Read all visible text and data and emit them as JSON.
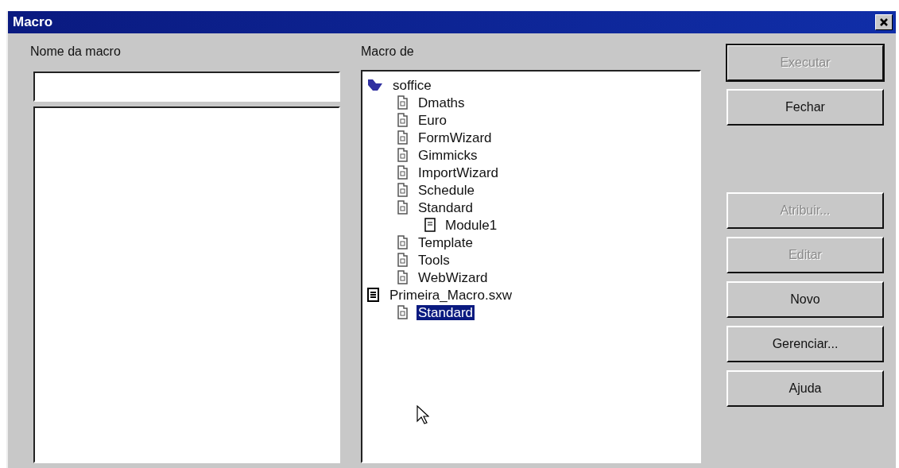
{
  "window": {
    "title": "Macro"
  },
  "macro_name": {
    "label": "Nome da macro"
  },
  "macro_from": {
    "label": "Macro de",
    "tree": [
      {
        "label": "soffice",
        "kind": "root",
        "selected": false,
        "children": [
          {
            "label": "Dmaths",
            "kind": "library",
            "selected": false
          },
          {
            "label": "Euro",
            "kind": "library",
            "selected": false
          },
          {
            "label": "FormWizard",
            "kind": "library",
            "selected": false
          },
          {
            "label": "Gimmicks",
            "kind": "library",
            "selected": false
          },
          {
            "label": "ImportWizard",
            "kind": "library",
            "selected": false
          },
          {
            "label": "Schedule",
            "kind": "library",
            "selected": false
          },
          {
            "label": "Standard",
            "kind": "library",
            "selected": false,
            "children": [
              {
                "label": "Module1",
                "kind": "module",
                "selected": false
              }
            ]
          },
          {
            "label": "Template",
            "kind": "library",
            "selected": false
          },
          {
            "label": "Tools",
            "kind": "library",
            "selected": false
          },
          {
            "label": "WebWizard",
            "kind": "library",
            "selected": false
          }
        ]
      },
      {
        "label": "Primeira_Macro.sxw",
        "kind": "document",
        "selected": false,
        "children": [
          {
            "label": "Standard",
            "kind": "library",
            "selected": true
          }
        ]
      }
    ]
  },
  "buttons": [
    {
      "label": "Executar",
      "disabled": true,
      "default": true
    },
    {
      "label": "Fechar",
      "disabled": false,
      "default": false
    },
    {
      "label": "Atribuir...",
      "disabled": true,
      "default": false
    },
    {
      "label": "Editar",
      "disabled": true,
      "default": false
    },
    {
      "label": "Novo",
      "disabled": false,
      "default": false
    },
    {
      "label": "Gerenciar...",
      "disabled": false,
      "default": false
    },
    {
      "label": "Ajuda",
      "disabled": false,
      "default": false
    }
  ]
}
